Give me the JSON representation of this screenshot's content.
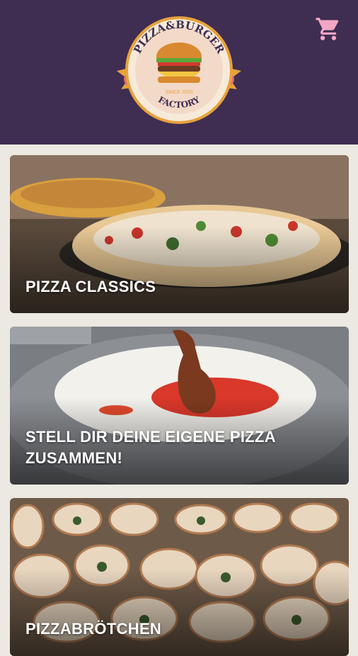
{
  "header": {
    "background": "#3f2d52",
    "logo": {
      "top_text": "PIZZA&BURGER",
      "bottom_text": "FACTORY",
      "tagline": "SINCE 2020"
    },
    "cart_icon": "shopping-cart-icon",
    "accent": "#f2a7c4"
  },
  "categories": [
    {
      "title": "PIZZA CLASSICS"
    },
    {
      "title": "STELL DIR DEINE EIGENE PIZZA ZUSAMMEN!"
    },
    {
      "title": "PIZZABRÖTCHEN"
    }
  ]
}
